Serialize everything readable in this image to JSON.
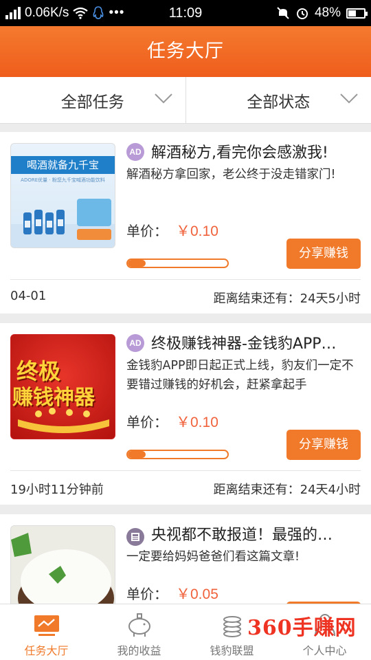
{
  "status_bar": {
    "network_speed": "0.06K/s",
    "time": "11:09",
    "battery": "48%"
  },
  "header": {
    "title": "任务大厅"
  },
  "filters": [
    {
      "label": "全部任务"
    },
    {
      "label": "全部状态"
    }
  ],
  "tasks": [
    {
      "badge": "AD",
      "title": "解酒秘方,看完你会感激我!",
      "description": "解酒秘方拿回家，老公终于没走错家门!",
      "price_label": "单价：",
      "price": "￥0.10",
      "progress": 0.18,
      "share_label": "分享赚钱",
      "date": "04-01",
      "remaining": "距离结束还有：24天5小时",
      "thumb_heading": "喝酒就备九千宝",
      "thumb_sub": "ADORE优量 · 粉您九千宝喊酒功能饮料"
    },
    {
      "badge": "AD",
      "title": "终极赚钱神器-金钱豹APP…",
      "description": "金钱豹APP即日起正式上线，豹友们一定不要错过赚钱的好机会，赶紧拿起手",
      "price_label": "单价：",
      "price": "￥0.10",
      "progress": 0.18,
      "share_label": "分享赚钱",
      "date": "19小时11分钟前",
      "remaining": "距离结束还有：24天4小时",
      "thumb_line1": "终极",
      "thumb_line2": "赚钱神器"
    },
    {
      "title": "央视都不敢报道！最强的…",
      "description": "一定要给妈妈爸爸们看这篇文章!",
      "price_label": "单价：",
      "price": "￥0.05"
    }
  ],
  "bottom_nav": [
    {
      "label": "任务大厅",
      "icon": "chart-icon",
      "active": true
    },
    {
      "label": "我的收益",
      "icon": "piggy-bank-icon"
    },
    {
      "label": "钱豹联盟",
      "icon": "coins-icon"
    },
    {
      "label": "个人中心",
      "icon": "user-icon"
    }
  ],
  "watermark": {
    "number": "360",
    "text": "手赚网"
  },
  "colors": {
    "accent": "#f07a2a",
    "price": "#f0623b",
    "ad_badge": "#b89ad6"
  }
}
